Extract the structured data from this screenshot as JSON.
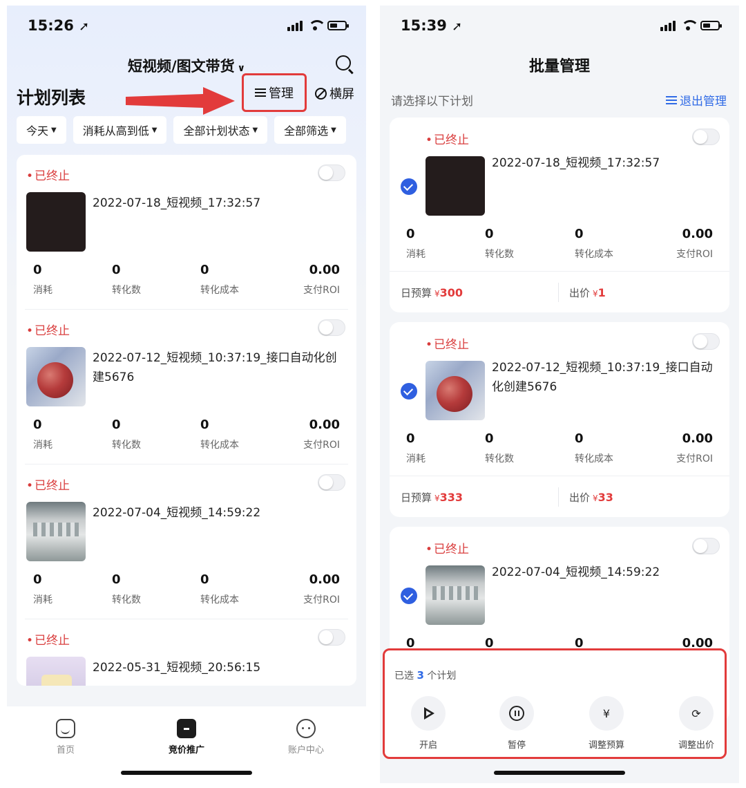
{
  "left": {
    "status_time": "15:26",
    "nav_title": "短视频/图文带货",
    "page_title": "计划列表",
    "manage_label": "管理",
    "rotate_label": "横屏",
    "filters": [
      "今天",
      "消耗从高到低",
      "全部计划状态",
      "全部筛选"
    ],
    "plans": [
      {
        "status": "已终止",
        "name": "2022-07-18_短视频_17:32:57",
        "spend": "0",
        "conversions": "0",
        "cost_per_conversion": "0",
        "roi": "0.00"
      },
      {
        "status": "已终止",
        "name": "2022-07-12_短视频_10:37:19_接口自动化创建5676",
        "spend": "0",
        "conversions": "0",
        "cost_per_conversion": "0",
        "roi": "0.00"
      },
      {
        "status": "已终止",
        "name": "2022-07-04_短视频_14:59:22",
        "spend": "0",
        "conversions": "0",
        "cost_per_conversion": "0",
        "roi": "0.00"
      },
      {
        "status": "已终止",
        "name": "2022-05-31_短视频_20:56:15"
      }
    ],
    "metric_labels": {
      "spend": "消耗",
      "conversions": "转化数",
      "cost": "转化成本",
      "roi": "支付ROI"
    },
    "tabs": [
      "首页",
      "竞价推广",
      "账户中心"
    ]
  },
  "right": {
    "status_time": "15:39",
    "title": "批量管理",
    "hint": "请选择以下计划",
    "exit_label": "退出管理",
    "plans": [
      {
        "status": "已终止",
        "name": "2022-07-18_短视频_17:32:57",
        "spend": "0",
        "conversions": "0",
        "cost_per_conversion": "0",
        "roi": "0.00",
        "daily_budget_label": "日预算",
        "daily_budget": "300",
        "bid_label": "出价",
        "bid": "1"
      },
      {
        "status": "已终止",
        "name": "2022-07-12_短视频_10:37:19_接口自动化创建5676",
        "spend": "0",
        "conversions": "0",
        "cost_per_conversion": "0",
        "roi": "0.00",
        "daily_budget_label": "日预算",
        "daily_budget": "333",
        "bid_label": "出价",
        "bid": "33"
      },
      {
        "status": "已终止",
        "name": "2022-07-04_短视频_14:59:22",
        "spend": "0",
        "conversions": "0",
        "cost_per_conversion": "0",
        "roi": "0.00"
      }
    ],
    "currency_symbol": "¥",
    "selected_prefix": "已选",
    "selected_count": "3",
    "selected_suffix": "个计划",
    "actions": [
      "开启",
      "暂停",
      "调整预算",
      "调整出价"
    ]
  },
  "colors": {
    "accent_red": "#e23b3b",
    "accent_blue": "#2f6ae6",
    "check_blue": "#2f5fe0"
  }
}
